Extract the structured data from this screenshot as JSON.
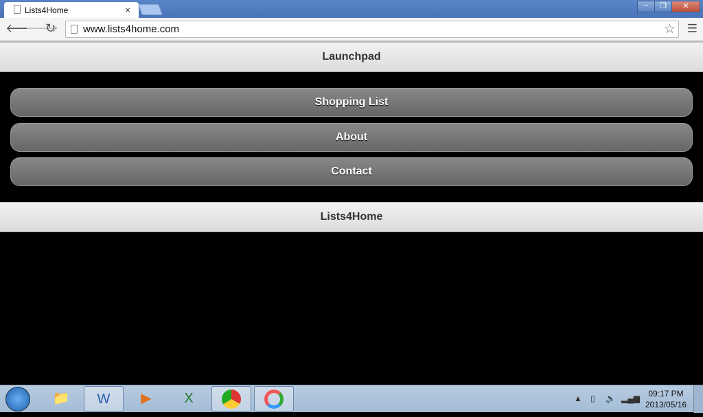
{
  "browser": {
    "tab_title": "Lists4Home",
    "url": "www.lists4home.com",
    "close_label": "×"
  },
  "page": {
    "header_title": "Launchpad",
    "buttons": [
      {
        "label": "Shopping List"
      },
      {
        "label": "About"
      },
      {
        "label": "Contact"
      }
    ],
    "footer_title": "Lists4Home"
  },
  "taskbar": {
    "time": "09:17 PM",
    "date": "2013/05/16",
    "apps": [
      "file-explorer-icon",
      "word-icon",
      "media-player-icon",
      "excel-icon",
      "chrome-icon",
      "power-app-icon"
    ]
  }
}
